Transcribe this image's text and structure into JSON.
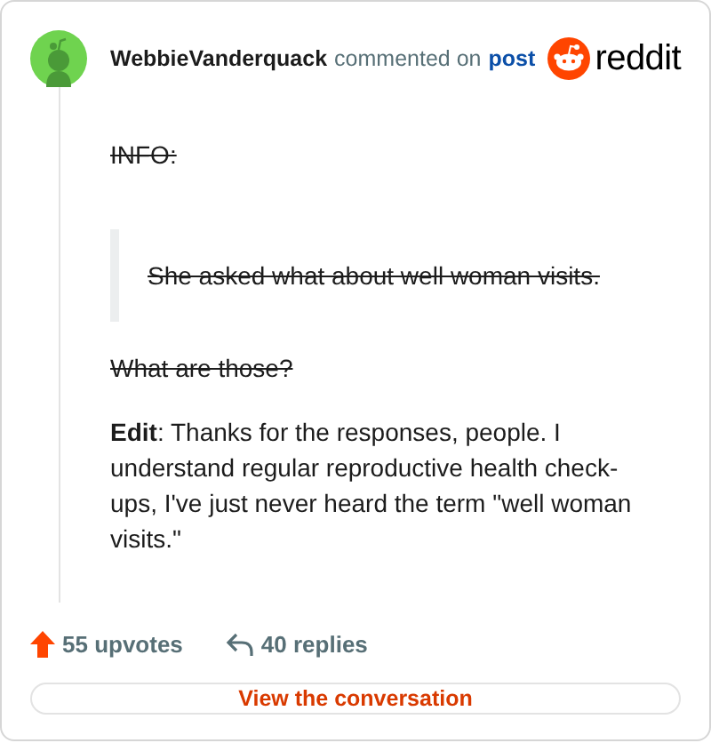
{
  "header": {
    "username": "WebbieVanderquack",
    "action": "commented on",
    "link": "post",
    "logo_text": "reddit"
  },
  "blocks": [
    {
      "kind": "paragraph",
      "text": "INFO:",
      "struck": true
    },
    {
      "kind": "quote",
      "text": "She asked what about well woman visits.",
      "struck": true
    },
    {
      "kind": "paragraph",
      "text": "What are those?",
      "struck": true
    },
    {
      "kind": "paragraph",
      "text": "**Edit**: Thanks for the responses, people. I understand regular reproductive health check-ups, I've just never heard the term \"well woman visits.\"",
      "struck": false
    }
  ],
  "footer": {
    "upvotes": "55 upvotes",
    "replies": "40 replies",
    "button": "View the conversation"
  }
}
